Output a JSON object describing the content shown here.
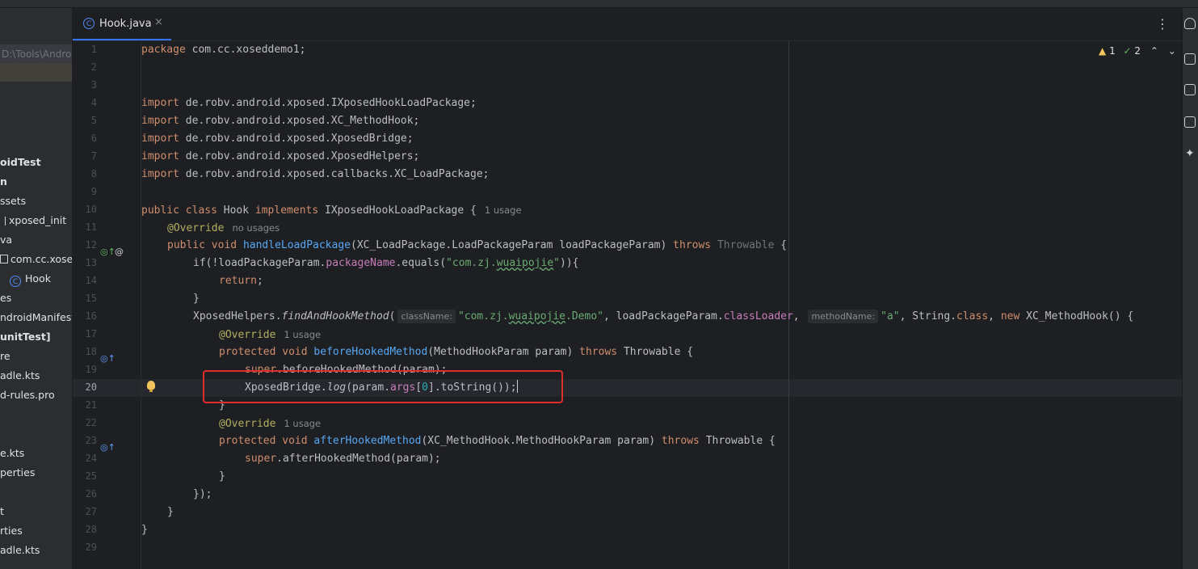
{
  "project": {
    "path_text": "D:\\Tools\\Andro",
    "items": [
      {
        "label": "oidTest",
        "bold": true,
        "icon": ""
      },
      {
        "label": "n",
        "bold": true,
        "icon": ""
      },
      {
        "label": "ssets",
        "bold": false,
        "icon": ""
      },
      {
        "label": "xposed_init",
        "bold": false,
        "icon": "file-icon"
      },
      {
        "label": "va",
        "bold": false,
        "icon": ""
      },
      {
        "label": "com.cc.xosed",
        "bold": false,
        "icon": "package-icon"
      },
      {
        "label": "Hook",
        "bold": false,
        "icon": "class-icon"
      },
      {
        "label": "es",
        "bold": false,
        "icon": ""
      },
      {
        "label": "ndroidManifest",
        "bold": false,
        "icon": ""
      },
      {
        "label": "unitTest]",
        "bold": true,
        "icon": ""
      },
      {
        "label": "re",
        "bold": false,
        "icon": ""
      },
      {
        "label": "adle.kts",
        "bold": false,
        "icon": ""
      },
      {
        "label": "d-rules.pro",
        "bold": false,
        "icon": ""
      },
      {
        "label": "e.kts",
        "bold": false,
        "icon": ""
      },
      {
        "label": "perties",
        "bold": false,
        "icon": ""
      },
      {
        "label": "t",
        "bold": false,
        "icon": ""
      },
      {
        "label": "rties",
        "bold": false,
        "icon": ""
      },
      {
        "label": "adle.kts",
        "bold": false,
        "icon": ""
      }
    ]
  },
  "editor": {
    "tab_label": "Hook.java",
    "tab_close": "×",
    "menu": "⋮",
    "inspections": {
      "warnings": "1",
      "weak_warnings": "2"
    },
    "current_line": "20",
    "line_numbers": [
      "1",
      "2",
      "3",
      "4",
      "5",
      "6",
      "7",
      "8",
      "9",
      "10",
      "11",
      "12",
      "13",
      "14",
      "15",
      "16",
      "17",
      "18",
      "19",
      "20",
      "21",
      "22",
      "23",
      "24",
      "25",
      "26",
      "27",
      "28",
      "29"
    ]
  },
  "code": {
    "pkg_kw": "package",
    "pkg_name": " com.cc.xoseddemo1;",
    "imp": "import",
    "imports": [
      " de.robv.android.xposed.IXposedHookLoadPackage;",
      " de.robv.android.xposed.XC_MethodHook;",
      " de.robv.android.xposed.XposedBridge;",
      " de.robv.android.xposed.XposedHelpers;",
      " de.robv.android.xposed.callbacks.XC_LoadPackage;"
    ],
    "l10_public": "public",
    "l10_class": " class",
    "l10_name": " Hook ",
    "l10_implements": "implements",
    "l10_rest": " IXposedHookLoadPackage {",
    "l10_hint": "1 usage",
    "l11_ann": "@Override",
    "l11_hint": "no usages",
    "l12_public": "public",
    "l12_void": " void ",
    "l12_method": "handleLoadPackage",
    "l12_params": "(XC_LoadPackage.LoadPackageParam loadPackageParam) ",
    "l12_throws": "throws",
    "l12_throwable": " Throwable",
    "l12_brace": " {",
    "l13_if": "if(!loadPackageParam.",
    "l13_field": "packageName",
    "l13_equals": ".equals(",
    "l13_str_a": "\"com.zj.",
    "l13_str_b": "wuaipojie",
    "l13_str_c": "\"",
    "l13_end": ")){",
    "l14_return": "return",
    "l14_semi": ";",
    "l15": "}",
    "l16_a": "XposedHelpers.",
    "l16_method": "findAndHookMethod",
    "l16_paren": "(",
    "l16_ph1": "className:",
    "l16_str1_a": "\"com.zj.",
    "l16_str1_b": "wuaipojie",
    "l16_str1_c": ".Demo\"",
    "l16_mid": ", loadPackageParam.",
    "l16_field": "classLoader",
    "l16_comma": ", ",
    "l16_ph2": "methodName:",
    "l16_str2": "\"a\"",
    "l16_c2": ", String.",
    "l16_class": "class",
    "l16_c3": ", ",
    "l16_new": "new",
    "l16_end": " XC_MethodHook() {",
    "l17_ann": "@Override",
    "l17_hint": "1 usage",
    "l18_protected": "protected",
    "l18_void": " void ",
    "l18_method": "beforeHookedMethod",
    "l18_params": "(MethodHookParam param) ",
    "l18_throws": "throws",
    "l18_end": " Throwable {",
    "l19_super": "super",
    "l19_rest": ".beforeHookedMethod(param);",
    "l20_a": "XposedBridge.",
    "l20_log": "log",
    "l20_b": "(param.",
    "l20_args": "args",
    "l20_c": "[",
    "l20_num": "0",
    "l20_d": "].toString());",
    "l21": "}",
    "l22_ann": "@Override",
    "l22_hint": "1 usage",
    "l23_protected": "protected",
    "l23_void": " void ",
    "l23_method": "afterHookedMethod",
    "l23_params": "(XC_MethodHook.MethodHookParam param) ",
    "l23_throws": "throws",
    "l23_end": " Throwable {",
    "l24_super": "super",
    "l24_rest": ".afterHookedMethod(param);",
    "l25": "}",
    "l26": "});",
    "l27": "}",
    "l28": "}"
  },
  "colors": {
    "keyword": "#cf8e6d",
    "annotation": "#b3ae60",
    "method": "#56a8f5",
    "string": "#6aab73",
    "field": "#c77dbb",
    "number": "#2aacb8",
    "highlight_box": "#e02c2c"
  }
}
